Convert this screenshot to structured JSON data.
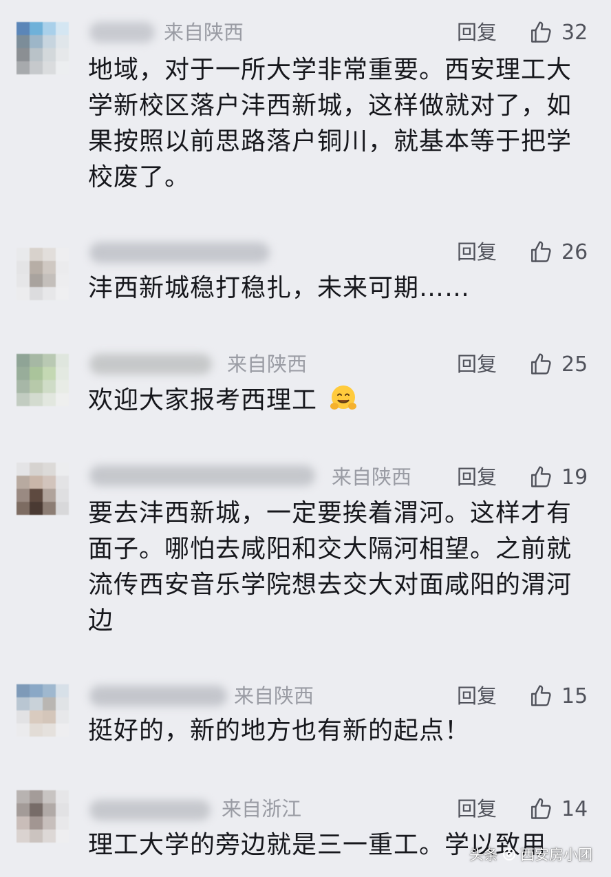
{
  "reply_label": "回复",
  "colors": {
    "background": "#ecedf1",
    "text": "#16171c",
    "meta": "#9a9ca4",
    "action": "#50525b"
  },
  "comments": [
    {
      "region": "来自陕西",
      "likes": "32",
      "text": "地域，对于一所大学非常重要。西安理工大学新校区落户沣西新城，这样做就对了，如果按照以前思路落户铜川，就基本等于把学校废了。"
    },
    {
      "region": "来自陕西",
      "likes": "26",
      "text": "沣西新城稳打稳扎，未来可期……"
    },
    {
      "region": "来自陕西",
      "likes": "25",
      "text": "欢迎大家报考西理工",
      "emoji": "hugging-face-emoji"
    },
    {
      "region": "来自陕西",
      "likes": "19",
      "text": "要去沣西新城，一定要挨着渭河。这样才有面子。哪怕去咸阳和交大隔河相望。之前就流传西安音乐学院想去交大对面咸阳的渭河边"
    },
    {
      "region": "来自陕西",
      "likes": "15",
      "text": "挺好的，新的地方也有新的起点！"
    },
    {
      "region": "来自浙江",
      "likes": "14",
      "text": "理工大学的旁边就是三一重工。学以致用"
    }
  ],
  "watermark": {
    "left": "头条",
    "right": "西安房小团"
  }
}
